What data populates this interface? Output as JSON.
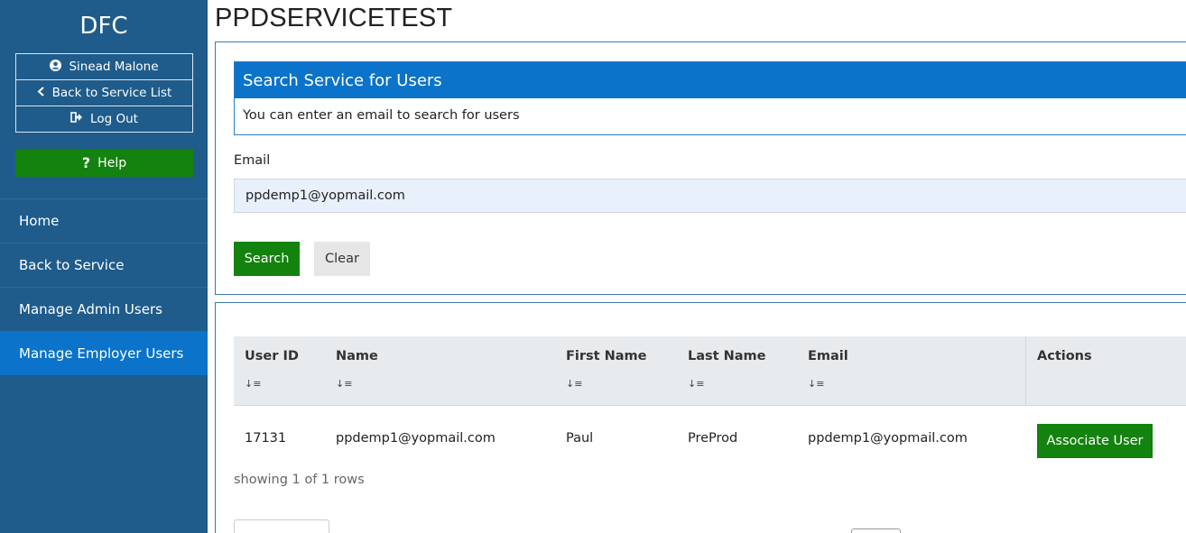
{
  "sidebar": {
    "brand": "DFC",
    "user_name": "Sinead Malone",
    "back_label": "Back to Service List",
    "logout_label": "Log Out",
    "help_label": "Help",
    "nav": [
      {
        "label": "Home",
        "active": false
      },
      {
        "label": "Back to Service",
        "active": false
      },
      {
        "label": "Manage Admin Users",
        "active": false
      },
      {
        "label": "Manage Employer Users",
        "active": true
      }
    ]
  },
  "page": {
    "title": "PPDSERVICETEST"
  },
  "search": {
    "header": "Search Service for Users",
    "subheader": "You can enter an email to search for users",
    "email_label": "Email",
    "email_value": "ppdemp1@yopmail.com",
    "search_button": "Search",
    "clear_button": "Clear"
  },
  "table": {
    "columns": [
      "User ID",
      "Name",
      "First Name",
      "Last Name",
      "Email",
      "Actions"
    ],
    "rows": [
      {
        "user_id": "17131",
        "name": "ppdemp1@yopmail.com",
        "first_name": "Paul",
        "last_name": "PreProd",
        "email": "ppdemp1@yopmail.com",
        "action": "Associate User"
      }
    ],
    "showing": "showing 1 of 1 rows"
  },
  "colors": {
    "sidebar_bg": "#1f5c8b",
    "active_nav": "#0b73c9",
    "primary_green": "#14820e",
    "header_blue": "#0b73c9"
  }
}
